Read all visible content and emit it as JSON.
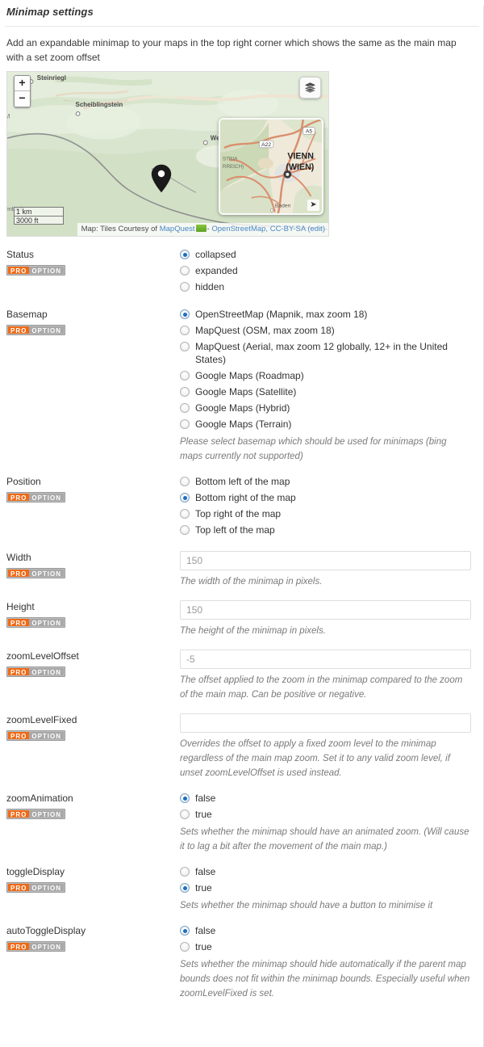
{
  "header": {
    "title": "Minimap settings",
    "intro": "Add an expandable minimap to your maps in the top right corner which shows the same as the main map with a set zoom offset"
  },
  "map": {
    "zoom_in_label": "+",
    "zoom_out_label": "−",
    "layers_icon": "layers-icon",
    "scale_metric": "1 km",
    "scale_imperial": "3000 ft",
    "attribution_prefix": "Map: Tiles Courtesy of",
    "attribution_mapquest": "MapQuest",
    "attribution_separator": "-",
    "attribution_osm": "OpenStreetMap, CC-BY-SA",
    "attribution_edit": "(edit)",
    "place_labels": [
      "Steinriegl",
      "Scheiblingstein",
      "Wei"
    ],
    "minimap_labels": {
      "highway_a5": "A5",
      "highway_a22": "A22",
      "region_1": "STRIA",
      "region_2": "RREICH)",
      "city_1": "VIENN",
      "city_2": "(WIEN)",
      "town": "Baden"
    },
    "minimap_toggle_icon": "minimise-arrow-icon"
  },
  "badge": {
    "pro": "PRO",
    "option": "OPTION"
  },
  "fields": [
    {
      "name": "status",
      "label": "Status",
      "type": "radio",
      "options": [
        {
          "label": "collapsed",
          "checked": true
        },
        {
          "label": "expanded",
          "checked": false
        },
        {
          "label": "hidden",
          "checked": false
        }
      ],
      "help": ""
    },
    {
      "name": "basemap",
      "label": "Basemap",
      "type": "radio",
      "options": [
        {
          "label": "OpenStreetMap (Mapnik, max zoom 18)",
          "checked": true
        },
        {
          "label": "MapQuest (OSM, max zoom 18)",
          "checked": false
        },
        {
          "label": "MapQuest (Aerial, max zoom 12 globally, 12+ in the United States)",
          "checked": false
        },
        {
          "label": "Google Maps (Roadmap)",
          "checked": false
        },
        {
          "label": "Google Maps (Satellite)",
          "checked": false
        },
        {
          "label": "Google Maps (Hybrid)",
          "checked": false
        },
        {
          "label": "Google Maps (Terrain)",
          "checked": false
        }
      ],
      "help": "Please select basemap which should be used for minimaps (bing maps currently not supported)"
    },
    {
      "name": "position",
      "label": "Position",
      "type": "radio",
      "options": [
        {
          "label": "Bottom left of the map",
          "checked": false
        },
        {
          "label": "Bottom right of the map",
          "checked": true
        },
        {
          "label": "Top right of the map",
          "checked": false
        },
        {
          "label": "Top left of the map",
          "checked": false
        }
      ],
      "help": ""
    },
    {
      "name": "width",
      "label": "Width",
      "type": "text",
      "value": "",
      "placeholder": "150",
      "help": "The width of the minimap in pixels."
    },
    {
      "name": "height",
      "label": "Height",
      "type": "text",
      "value": "",
      "placeholder": "150",
      "help": "The height of the minimap in pixels."
    },
    {
      "name": "zoomLevelOffset",
      "label": "zoomLevelOffset",
      "type": "text",
      "value": "",
      "placeholder": "-5",
      "help": "The offset applied to the zoom in the minimap compared to the zoom of the main map. Can be positive or negative."
    },
    {
      "name": "zoomLevelFixed",
      "label": "zoomLevelFixed",
      "type": "text",
      "value": "",
      "placeholder": "",
      "help": "Overrides the offset to apply a fixed zoom level to the minimap regardless of the main map zoom. Set it to any valid zoom level, if unset zoomLevelOffset is used instead."
    },
    {
      "name": "zoomAnimation",
      "label": "zoomAnimation",
      "type": "radio",
      "options": [
        {
          "label": "false",
          "checked": true
        },
        {
          "label": "true",
          "checked": false
        }
      ],
      "help": "Sets whether the minimap should have an animated zoom. (Will cause it to lag a bit after the movement of the main map.)"
    },
    {
      "name": "toggleDisplay",
      "label": "toggleDisplay",
      "type": "radio",
      "options": [
        {
          "label": "false",
          "checked": false
        },
        {
          "label": "true",
          "checked": true
        }
      ],
      "help": "Sets whether the minimap should have a button to minimise it"
    },
    {
      "name": "autoToggleDisplay",
      "label": "autoToggleDisplay",
      "type": "radio",
      "options": [
        {
          "label": "false",
          "checked": true
        },
        {
          "label": "true",
          "checked": false
        }
      ],
      "help": "Sets whether the minimap should hide automatically if the parent map bounds does not fit within the minimap bounds. Especially useful when zoomLevelFixed is set."
    }
  ]
}
